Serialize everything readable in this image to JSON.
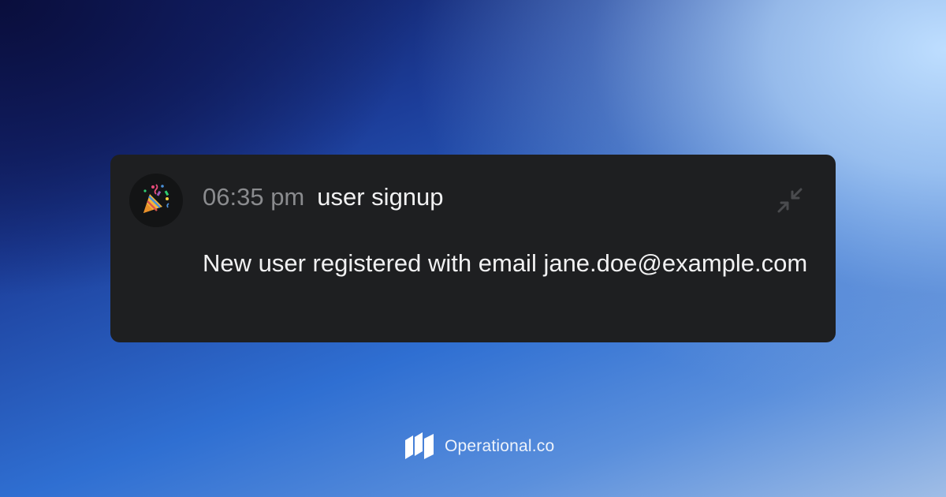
{
  "notification": {
    "time": "06:35 pm",
    "event": "user signup",
    "message": "New user registered with email jane.doe@example.com",
    "avatar_icon": "party-popper-icon",
    "collapse_icon": "collapse-arrows-icon"
  },
  "brand": {
    "name": "Operational.co",
    "logo_icon": "operational-logo-icon"
  },
  "colors": {
    "card_background": "#1e1f21",
    "time_text": "#8a8b8e",
    "primary_text": "#f1f1f2",
    "icon_muted": "#4a4b4e"
  }
}
